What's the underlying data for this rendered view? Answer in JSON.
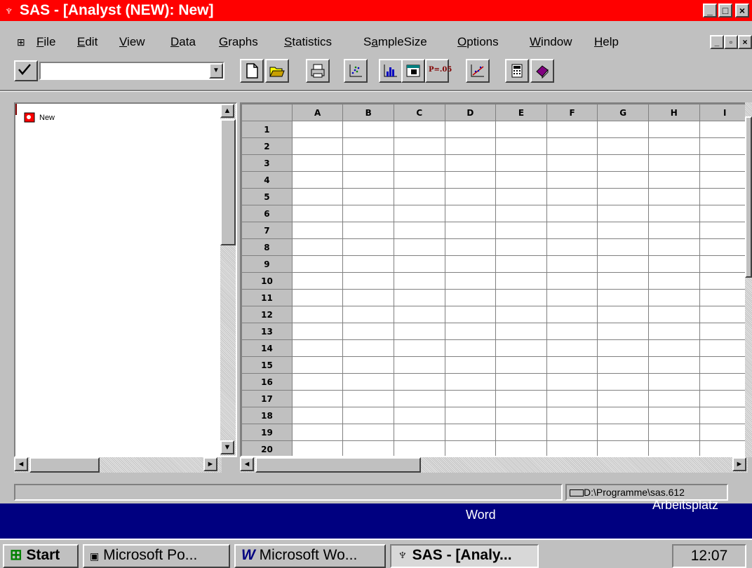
{
  "window": {
    "title": "SAS - [Analyst (NEW): New]"
  },
  "menu": [
    "File",
    "Edit",
    "View",
    "Data",
    "Graphs",
    "Statistics",
    "SampleSize",
    "Options",
    "Window",
    "Help"
  ],
  "tree": {
    "item": "New"
  },
  "grid": {
    "columns": [
      "A",
      "B",
      "C",
      "D",
      "E",
      "F",
      "G",
      "H",
      "I"
    ],
    "rows": [
      "1",
      "2",
      "3",
      "4",
      "5",
      "6",
      "7",
      "8",
      "9",
      "10",
      "11",
      "12",
      "13",
      "14",
      "15",
      "16",
      "17",
      "18",
      "19",
      "20"
    ]
  },
  "status": {
    "path": "D:\\Programme\\sas.612"
  },
  "desktop": {
    "word": "Word",
    "arbeitsplatz": "Arbeitsplatz"
  },
  "taskbar": {
    "start": "Start",
    "items": [
      "Microsoft Po...",
      "Microsoft Wo...",
      "SAS - [Analy..."
    ],
    "clock": "12:07"
  },
  "colors": {
    "titlebar": "#ff0000",
    "desktop": "#000080",
    "face": "#c0c0c0"
  },
  "toolbar": {
    "pvalue_label": "P=.05",
    "icons": [
      "check-icon",
      "new-file-icon",
      "open-folder-icon",
      "print-icon",
      "scatter-plot-icon",
      "histogram-icon",
      "table-icon",
      "p-value-icon",
      "regression-icon",
      "calculator-icon",
      "help-book-icon"
    ]
  }
}
